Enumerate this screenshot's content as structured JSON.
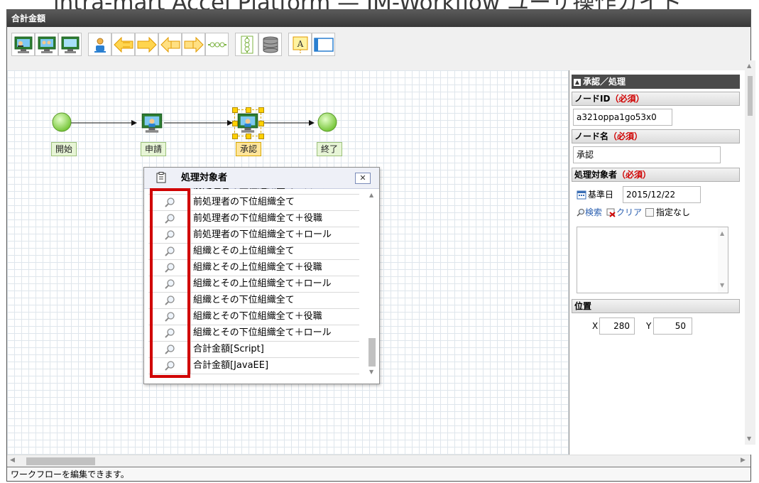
{
  "banner": {
    "text": "intra-mart Accel Platform — IM-Workflow ユーザ操作ガイド"
  },
  "window": {
    "title": "合計金額"
  },
  "toolbar": {
    "buttons": [
      {
        "name": "process-node-button",
        "icon": "monitor-person-icon"
      },
      {
        "name": "multi-process-node-button",
        "icon": "monitor-persons-icon"
      },
      {
        "name": "system-node-button",
        "icon": "monitor-icon"
      },
      {
        "name": "user-node-button",
        "icon": "person-icon"
      },
      {
        "name": "branch-start-node-button",
        "icon": "branch-start-icon"
      },
      {
        "name": "branch-end-node-button",
        "icon": "branch-end-icon"
      },
      {
        "name": "split-start-node-button",
        "icon": "split-start-icon"
      },
      {
        "name": "split-end-node-button",
        "icon": "split-end-icon"
      },
      {
        "name": "horizontal-line-node-button",
        "icon": "horizontal-dots-icon"
      },
      {
        "name": "vertical-line-node-button",
        "icon": "vertical-dots-icon"
      },
      {
        "name": "database-node-button",
        "icon": "database-icon"
      },
      {
        "name": "text-node-button",
        "icon": "text-a-icon"
      },
      {
        "name": "frame-node-button",
        "icon": "frame-icon"
      }
    ]
  },
  "canvas": {
    "nodes": [
      {
        "label": "開始",
        "type": "start"
      },
      {
        "label": "申請",
        "type": "apply"
      },
      {
        "label": "承認",
        "type": "approve",
        "selected": true
      },
      {
        "label": "終了",
        "type": "end"
      }
    ]
  },
  "dialog": {
    "title": "処理対象者",
    "partial_row": "前処理者の上位組織全て＋ロール",
    "rows": [
      "前処理者の下位組織全て",
      "前処理者の下位組織全て＋役職",
      "前処理者の下位組織全て＋ロール",
      "組織とその上位組織全て",
      "組織とその上位組織全て＋役職",
      "組織とその上位組織全て＋ロール",
      "組織とその下位組織全て",
      "組織とその下位組織全て＋役職",
      "組織とその下位組織全て＋ロール",
      "合計金額[Script]",
      "合計金額[JavaEE]"
    ]
  },
  "props": {
    "header": "承認／処理",
    "node_id": {
      "label": "ノードID",
      "required": "（必須）",
      "value": "a321oppa1go53x0"
    },
    "node_name": {
      "label": "ノード名",
      "required": "（必須）",
      "value": "承認"
    },
    "target": {
      "label": "処理対象者",
      "required": "（必須）",
      "base_date_label": "基準日",
      "base_date": "2015/12/22",
      "search_label": "検索",
      "clear_label": "クリア",
      "none_label": "指定なし",
      "none_checked": false
    },
    "position": {
      "label": "位置",
      "x_label": "X",
      "x": "280",
      "y_label": "Y",
      "y": "50"
    }
  },
  "status": {
    "text": "ワークフローを編集できます。"
  },
  "colors": {
    "highlight_box": "#d00000",
    "node_green": "#8fd84a",
    "title_bar": "#4a4a4a"
  }
}
